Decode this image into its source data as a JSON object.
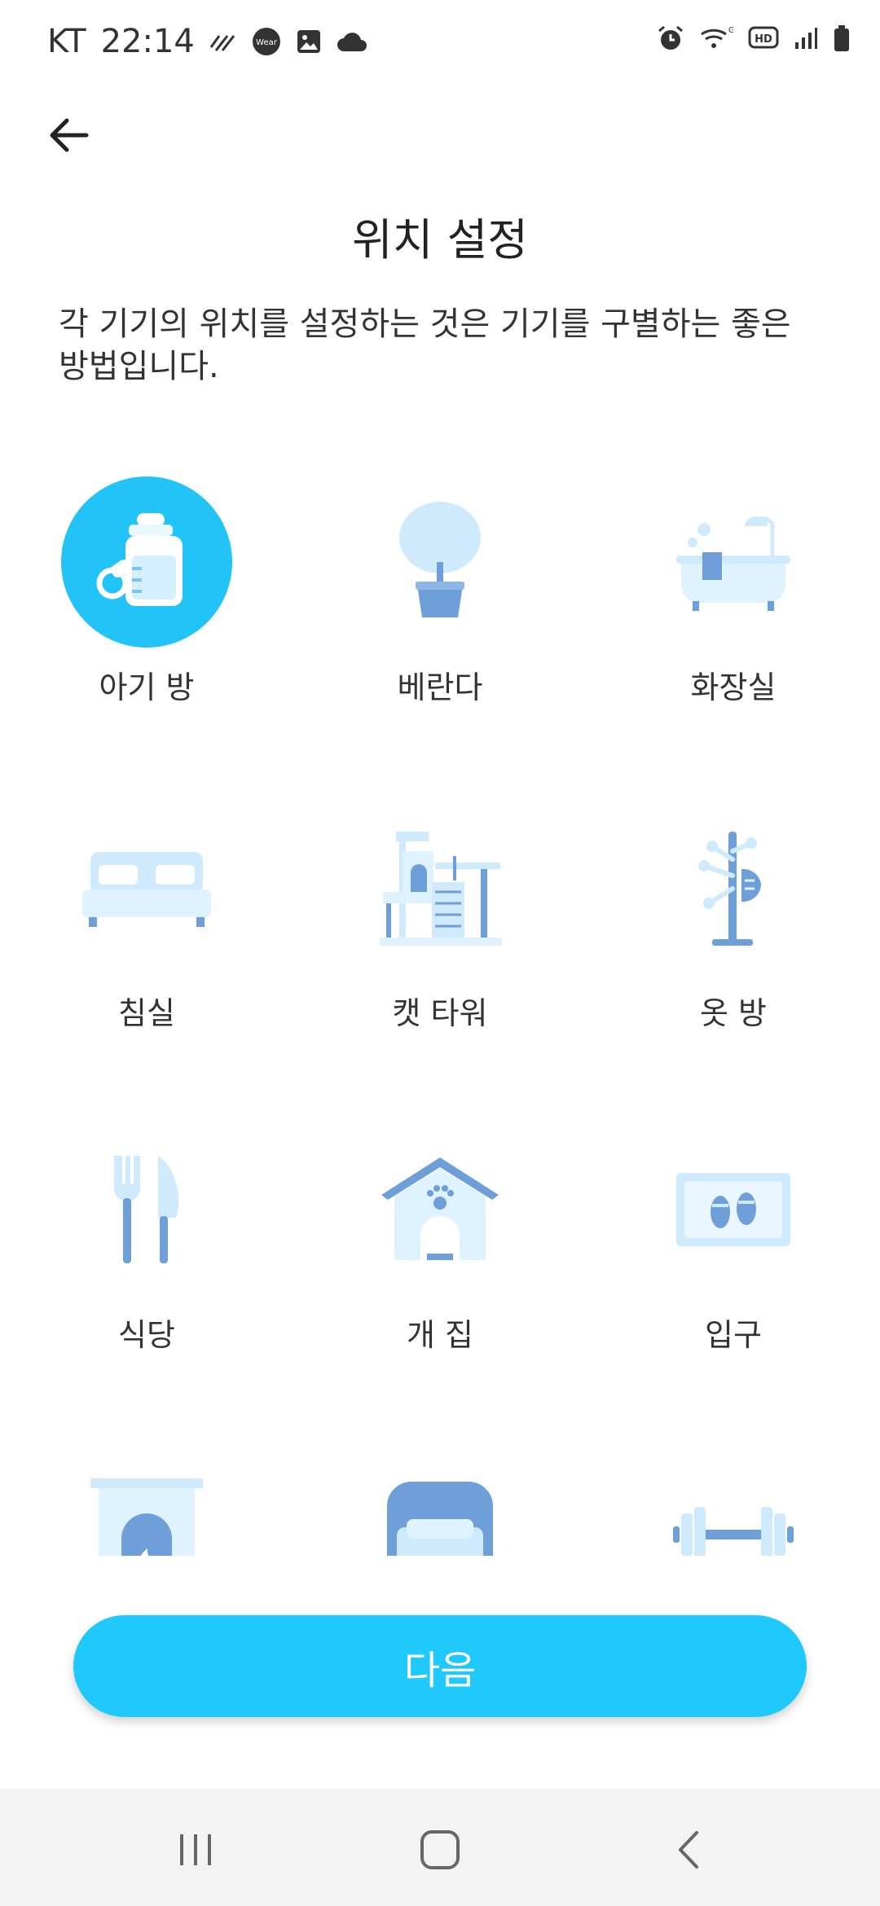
{
  "status_bar": {
    "carrier": "KT",
    "time": "22:14",
    "icons_left": [
      "activity-icon",
      "wear-icon",
      "gallery-icon",
      "cloud-icon"
    ],
    "icons_right": [
      "alarm-icon",
      "wifi-icon",
      "hd-voice-icon",
      "signal-icon",
      "battery-icon"
    ],
    "wear_label": "Wear",
    "hd_label": "HD"
  },
  "header": {
    "title": "위치 설정",
    "description": "각 기기의 위치를 설정하는 것은 기기를 구별하는 좋은 방법입니다."
  },
  "locations": [
    {
      "label": "아기 방",
      "icon": "baby-bottle-icon",
      "selected": true
    },
    {
      "label": "베란다",
      "icon": "potted-tree-icon",
      "selected": false
    },
    {
      "label": "화장실",
      "icon": "bathtub-icon",
      "selected": false
    },
    {
      "label": "침실",
      "icon": "bed-icon",
      "selected": false
    },
    {
      "label": "캣 타워",
      "icon": "cat-tower-icon",
      "selected": false
    },
    {
      "label": "옷 방",
      "icon": "coat-rack-icon",
      "selected": false
    },
    {
      "label": "식당",
      "icon": "fork-knife-icon",
      "selected": false
    },
    {
      "label": "개 집",
      "icon": "dog-house-icon",
      "selected": false
    },
    {
      "label": "입구",
      "icon": "doormat-icon",
      "selected": false
    },
    {
      "label": "",
      "icon": "fireplace-icon",
      "selected": false
    },
    {
      "label": "",
      "icon": "garage-car-icon",
      "selected": false
    },
    {
      "label": "",
      "icon": "dumbbell-icon",
      "selected": false
    }
  ],
  "next_button": {
    "label": "다음"
  },
  "colors": {
    "accent": "#20c9fc",
    "icon_light": "#cfeafd",
    "icon_dark": "#6e9fd8"
  }
}
